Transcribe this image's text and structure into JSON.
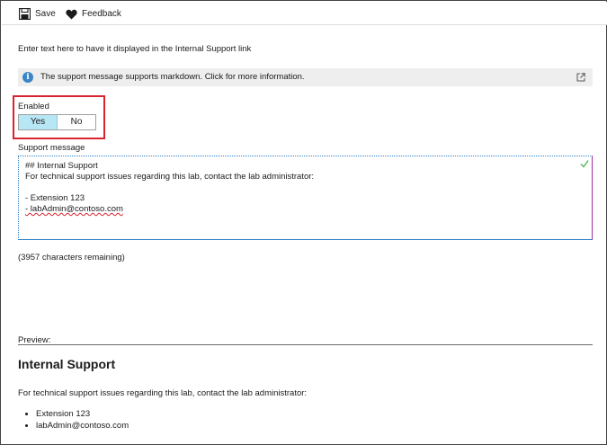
{
  "toolbar": {
    "save_label": "Save",
    "save_icon": "save-icon",
    "feedback_label": "Feedback",
    "feedback_icon": "heart-icon"
  },
  "description": "Enter text here to have it displayed in the Internal Support link",
  "info_bar": {
    "text": "The support message supports markdown. Click for more information.",
    "info_icon": "i",
    "external_icon": "external-link-icon"
  },
  "enabled": {
    "label": "Enabled",
    "options": [
      "Yes",
      "No"
    ],
    "selected": "Yes",
    "highlight_color": "#d8242f"
  },
  "support_message": {
    "label": "Support message",
    "lines": [
      "## Internal Support",
      "For technical support issues regarding this lab, contact the lab administrator:",
      "",
      "- Extension 123",
      "- labAdmin@contoso.com"
    ]
  },
  "remaining": "(3957 characters remaining)",
  "preview": {
    "label": "Preview:",
    "title": "Internal Support",
    "paragraph": "For technical support issues regarding this lab, contact the lab administrator:",
    "items": [
      "Extension 123",
      "labAdmin@contoso.com"
    ]
  },
  "colors": {
    "toggle_selected": "#b7e6f5",
    "info_icon": "#3a85c6",
    "valid_check": "#5cb85c"
  }
}
